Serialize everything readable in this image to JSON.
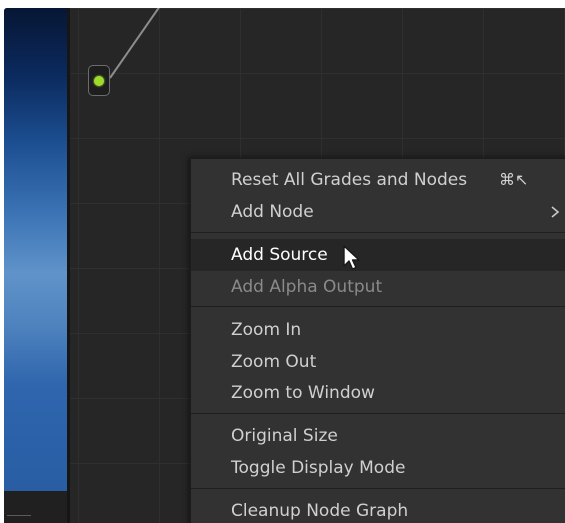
{
  "menu": {
    "items": [
      {
        "label": "Reset All Grades and Nodes",
        "shortcut": "⌘↖"
      },
      {
        "label": "Add Node",
        "has_submenu": true,
        "chevron": "›"
      },
      {
        "label": "Add Source",
        "highlighted": true
      },
      {
        "label": "Add Alpha Output",
        "disabled": true
      },
      {
        "label": "Zoom In"
      },
      {
        "label": "Zoom Out"
      },
      {
        "label": "Zoom to Window"
      },
      {
        "label": "Original Size"
      },
      {
        "label": "Toggle Display Mode"
      },
      {
        "label": "Cleanup Node Graph"
      }
    ]
  },
  "colors": {
    "node_output_dot": "#9fdb2a",
    "menu_background": "#323232",
    "menu_highlight": "#262626",
    "graph_background": "#262626"
  },
  "icons": {
    "cursor": "arrow-pointer-icon",
    "node_output": "output-port-icon",
    "submenu": "chevron-right-icon"
  }
}
